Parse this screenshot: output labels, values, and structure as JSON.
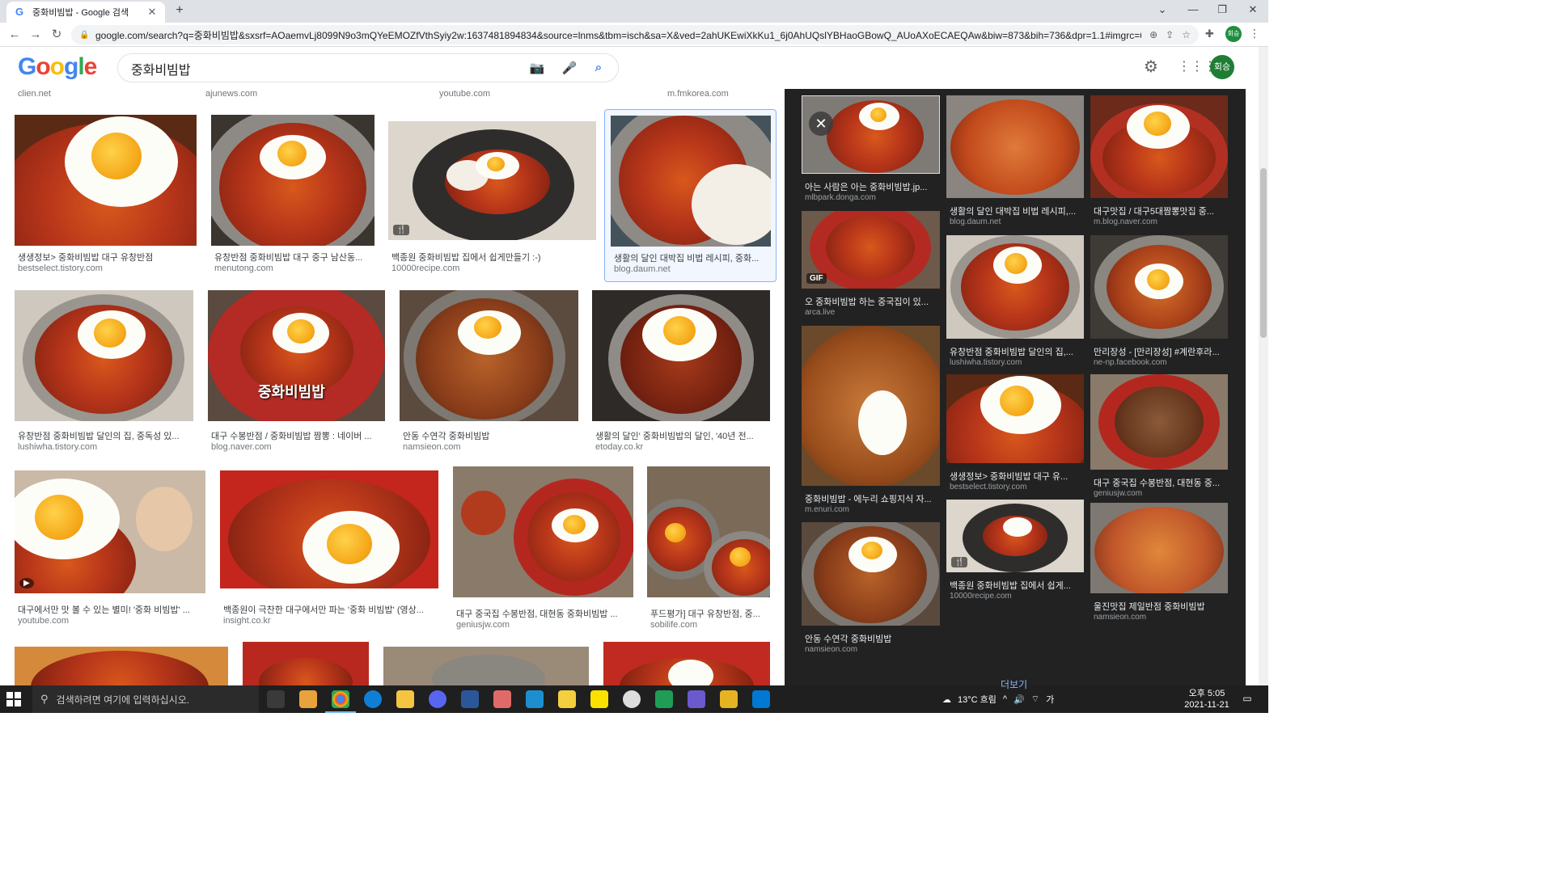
{
  "browser": {
    "tab_title": "중화비빔밥 - Google 검색",
    "tab_favicon": "G",
    "url": "google.com/search?q=중화비빔밥&sxsrf=AOaemvLj8099N9o3mQYeEMOZfVthSyiy2w:1637481894834&source=lnms&tbm=isch&sa=X&ved=2ahUKEwiXkKu1_6j0AhUQslYBHaoGBowQ_AUoAXoECAEQAw&biw=873&bih=736&dpr=1.1#imgrc=686q...",
    "profile_initial": "회승"
  },
  "google": {
    "logo": [
      "G",
      "o",
      "o",
      "g",
      "l",
      "e"
    ],
    "query": "중화비빔밥",
    "avatar_label": "회승"
  },
  "top_sources": [
    "clien.net",
    "ajunews.com",
    "youtube.com",
    "m.fmkorea.com"
  ],
  "results": [
    {
      "caption": "생생정보> 중화비빔밥 대구 유창반점",
      "source": "bestselect.tistory.com"
    },
    {
      "caption": "유창반점 중화비빔밥 대구 중구 남산동...",
      "source": "menutong.com"
    },
    {
      "caption": "백종원 중화비빔밥 집에서 쉽게만들기 :-)",
      "source": "10000recipe.com",
      "badge": "🍴"
    },
    {
      "caption": "생활의 달인 대박집 비법 레시피, 중화...",
      "source": "blog.daum.net"
    },
    {
      "caption": "유창반점 중화비빔밥 달인의 집, 중독성 있...",
      "source": "lushiwha.tistory.com"
    },
    {
      "caption": "대구 수봉반점 / 중화비빔밥 짬뽕 : 네이버 ...",
      "source": "blog.naver.com",
      "overlay": "중화비빔밥"
    },
    {
      "caption": "안동 수연각 중화비빔밥",
      "source": "namsieon.com"
    },
    {
      "caption": "생활의 달인' 중화비빔밥의 달인, '40년 전...",
      "source": "etoday.co.kr"
    },
    {
      "caption": "대구에서만 맛 볼 수 있는 별미! '중화 비빔밥' ...",
      "source": "youtube.com"
    },
    {
      "caption": "백종원이 극찬한 대구에서만 파는 '중화 비빔밥' (영상...",
      "source": "insight.co.kr"
    },
    {
      "caption": "대구 중국집 수봉반점, 대현동 중화비빔밥 ...",
      "source": "geniusjw.com"
    },
    {
      "caption": "푸드평가] 대구 유창반점, 중...",
      "source": "sobilife.com"
    }
  ],
  "panel": {
    "more_label": "더보기",
    "items": [
      {
        "caption": "아는 사람은 아는 중화비빔밥.jp...",
        "source": "mlbpark.donga.com"
      },
      {
        "caption": "생활의 달인 대박집 비법 레시피,...",
        "source": "blog.daum.net"
      },
      {
        "caption": "대구맛집 / 대구5대짬뽕맛집 중...",
        "source": "m.blog.naver.com"
      },
      {
        "caption": "오 중화비빔밥 하는 중국집이 있...",
        "source": "arca.live",
        "badge": "GIF"
      },
      {
        "caption": "유창반점 중화비빔밥 달인의 집,...",
        "source": "lushiwha.tistory.com"
      },
      {
        "caption": "만리장성 - [만리장성] #계란후라...",
        "source": "ne-np.facebook.com"
      },
      {
        "caption": "중화비빔밥 - 에누리 쇼핑지식 자...",
        "source": "m.enuri.com"
      },
      {
        "caption": "생생정보> 중화비빔밥 대구 유...",
        "source": "bestselect.tistory.com"
      },
      {
        "caption": "대구 중국집 수봉반점, 대현동 중...",
        "source": "geniusjw.com"
      },
      {
        "caption": "백종원 중화비빔밥 집에서 쉽게...",
        "source": "10000recipe.com",
        "badge": "🍴"
      },
      {
        "caption": "안동 수연각 중화비빔밥",
        "source": "namsieon.com"
      },
      {
        "caption": "울진맛집 제일반점 중화비빔밥",
        "source": "namsieon.com"
      }
    ]
  },
  "taskbar": {
    "search_placeholder": "검색하려면 여기에 입력하십시오.",
    "weather": "13°C 흐림",
    "time": "오후 5:05",
    "date": "2021-11-21"
  },
  "colors": {
    "accent": "#1a73e8",
    "panel_bg": "#222222",
    "taskbar_bg": "#1f1f1f"
  }
}
